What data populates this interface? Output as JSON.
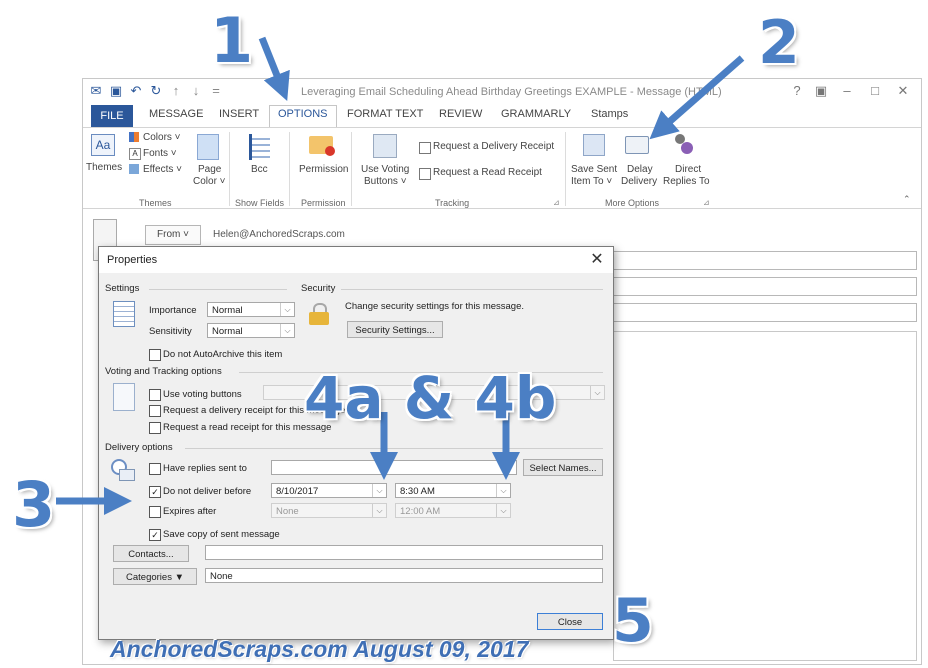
{
  "window": {
    "title": "Leveraging Email Scheduling Ahead Birthday Greetings EXAMPLE - Message (HTML)",
    "controls": [
      "?",
      "▣",
      "–",
      "□",
      "✕"
    ]
  },
  "ribbon_tabs": [
    "FILE",
    "MESSAGE",
    "INSERT",
    "OPTIONS",
    "FORMAT TEXT",
    "REVIEW",
    "GRAMMARLY",
    "Stamps"
  ],
  "ribbon": {
    "themes": {
      "themes": "Themes",
      "colors": "Colors ˅",
      "fonts": "Fonts ˅",
      "effects": "Effects ˅",
      "page_color_1": "Page",
      "page_color_2": "Color ˅",
      "group": "Themes"
    },
    "show_fields": {
      "bcc": "Bcc",
      "group": "Show Fields"
    },
    "permission": {
      "permission": "Permission",
      "group": "Permission"
    },
    "tracking": {
      "use_voting_1": "Use Voting",
      "use_voting_2": "Buttons ˅",
      "delivery_receipt": "Request a Delivery Receipt",
      "read_receipt": "Request a Read Receipt",
      "group": "Tracking"
    },
    "more_options": {
      "save_sent_1": "Save Sent",
      "save_sent_2": "Item To ˅",
      "delay_1": "Delay",
      "delay_2": "Delivery",
      "direct_1": "Direct",
      "direct_2": "Replies To",
      "group": "More Options"
    }
  },
  "message": {
    "from_label": "From ˅",
    "from_value": "Helen@AnchoredScraps.com"
  },
  "dialog": {
    "title": "Properties",
    "settings": {
      "heading": "Settings",
      "importance_label": "Importance",
      "importance_value": "Normal",
      "sensitivity_label": "Sensitivity",
      "sensitivity_value": "Normal",
      "no_autoarchive": "Do not AutoArchive this item"
    },
    "security": {
      "heading": "Security",
      "text": "Change security settings for this message.",
      "button": "Security Settings..."
    },
    "voting": {
      "heading": "Voting and Tracking options",
      "use_voting": "Use voting buttons",
      "delivery_receipt": "Request a delivery receipt for this message",
      "read_receipt": "Request a read receipt for this message"
    },
    "delivery": {
      "heading": "Delivery options",
      "have_replies": "Have replies sent to",
      "select_names": "Select Names...",
      "do_not_deliver": "Do not deliver before",
      "deliver_date": "8/10/2017",
      "deliver_time": "8:30 AM",
      "expires_after": "Expires after",
      "expires_date": "None",
      "expires_time": "12:00 AM",
      "save_copy": "Save copy of sent message"
    },
    "contacts_button": "Contacts...",
    "categories_button": "Categories ▼",
    "categories_value": "None",
    "close_button": "Close"
  },
  "annotations": {
    "n1": "1",
    "n2": "2",
    "n3": "3",
    "n4": "4a & 4b",
    "n5": "5",
    "watermark": "AnchoredScraps.com August 09, 2017"
  },
  "colors": {
    "accent": "#2b579a",
    "annotation": "#4b7fc4",
    "dialog_bg": "#f0f0f0"
  }
}
